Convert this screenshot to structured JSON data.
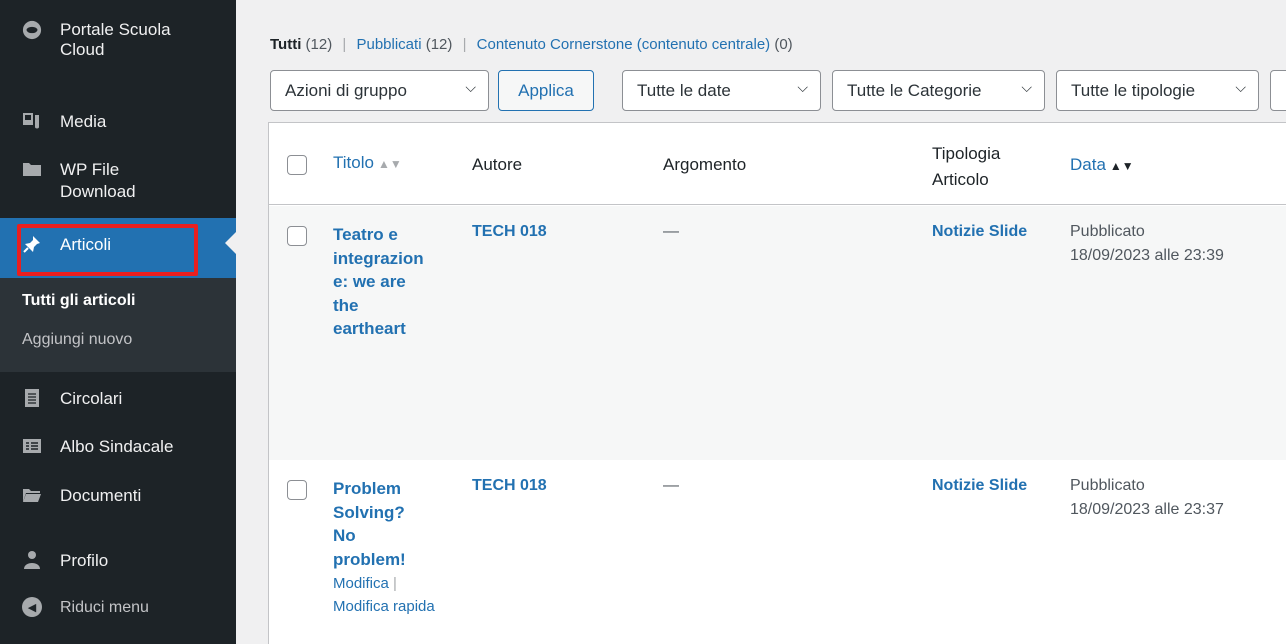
{
  "sidebar": {
    "site_name": "Portale Scuola Cloud",
    "items": [
      {
        "label": "Media",
        "icon": "media-icon"
      },
      {
        "label": "WP File Download",
        "icon": "folder-icon"
      },
      {
        "label": "Articoli",
        "icon": "pushpin-icon",
        "active": true
      },
      {
        "label": "Circolari",
        "icon": "document-icon"
      },
      {
        "label": "Albo Sindacale",
        "icon": "list-icon"
      },
      {
        "label": "Documenti",
        "icon": "folder-open-icon"
      },
      {
        "label": "Profilo",
        "icon": "user-icon"
      }
    ],
    "submenu": {
      "all_posts": "Tutti gli articoli",
      "add_new": "Aggiungi nuovo"
    },
    "collapse_label": "Riduci menu"
  },
  "filters": {
    "all_label": "Tutti",
    "all_count": "(12)",
    "published_label": "Pubblicati",
    "published_count": "(12)",
    "cornerstone_label": "Contenuto Cornerstone (contenuto centrale)",
    "cornerstone_count": "(0)",
    "separator": "|"
  },
  "toolbar": {
    "bulk_actions": "Azioni di gruppo",
    "apply": "Applica",
    "dates": "Tutte le date",
    "categories": "Tutte le Categorie",
    "types": "Tutte le tipologie"
  },
  "table": {
    "headers": {
      "title": "Titolo",
      "author": "Autore",
      "topic": "Argomento",
      "type_line1": "Tipologia",
      "type_line2": "Articolo",
      "date": "Data"
    },
    "rows": [
      {
        "title_lines": [
          "Teatro e",
          "integrazion",
          "e: we are",
          "the",
          "eartheart"
        ],
        "author": "TECH 018",
        "topic": "—",
        "type": "Notizie Slide",
        "status": "Pubblicato",
        "date": "18/09/2023 alle 23:39"
      },
      {
        "title_lines": [
          "Problem",
          "Solving?",
          "No",
          "problem!"
        ],
        "author": "TECH 018",
        "topic": "—",
        "type": "Notizie Slide",
        "status": "Pubblicato",
        "date": "18/09/2023 alle 23:37",
        "actions": {
          "edit": "Modifica",
          "separator": "|",
          "quick_edit": "Modifica rapida"
        }
      }
    ]
  },
  "colors": {
    "sidebar_bg": "#1d2327",
    "accent": "#2271b1",
    "highlight_box": "#ea1f1f"
  }
}
